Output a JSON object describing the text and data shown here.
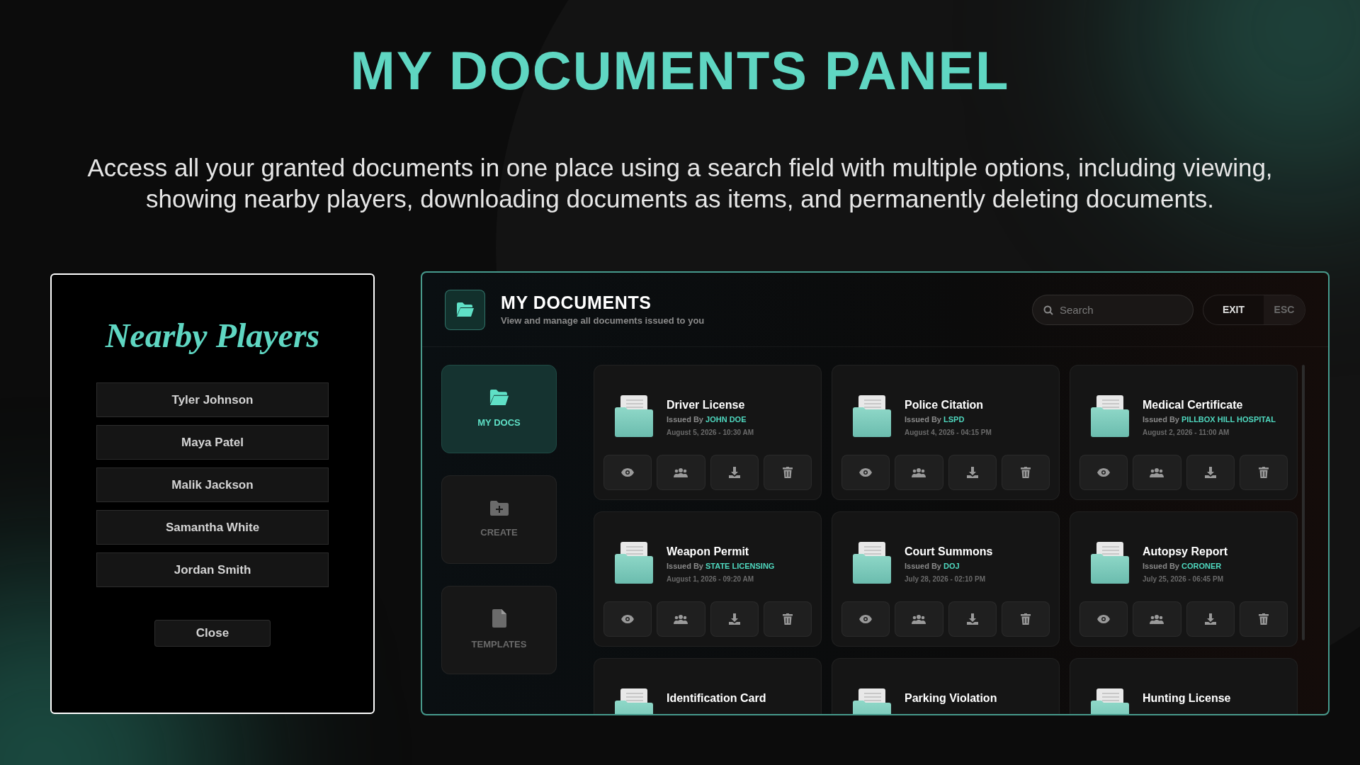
{
  "page": {
    "title": "MY DOCUMENTS PANEL",
    "description": "Access all your granted documents in one place using a search field with multiple options, including viewing, showing nearby players, downloading documents as items, and permanently deleting documents."
  },
  "nearby_players": {
    "title": "Nearby Players",
    "players": [
      "Tyler Johnson",
      "Maya Patel",
      "Malik Jackson",
      "Samantha White",
      "Jordan Smith"
    ],
    "close": "Close"
  },
  "documents_panel": {
    "title": "MY DOCUMENTS",
    "subtitle": "View and manage all documents issued to you",
    "search": {
      "placeholder": "Search"
    },
    "exit": "EXIT",
    "esc": "ESC",
    "nav": [
      {
        "label": "MY DOCS",
        "kind": "docs",
        "selected": true
      },
      {
        "label": "CREATE",
        "kind": "create",
        "selected": false
      },
      {
        "label": "TEMPLATES",
        "kind": "templates",
        "selected": false
      }
    ],
    "documents": [
      {
        "title": "Driver License",
        "issued_by": "Issued By",
        "issuer": "JOHN DOE",
        "date": "August 5, 2026 - 10:30 AM"
      },
      {
        "title": "Police Citation",
        "issued_by": "Issued By",
        "issuer": "LSPD",
        "date": "August 4, 2026 - 04:15 PM"
      },
      {
        "title": "Medical Certificate",
        "issued_by": "Issued By",
        "issuer": "PILLBOX HILL HOSPITAL",
        "date": "August 2, 2026 - 11:00 AM"
      },
      {
        "title": "Weapon Permit",
        "issued_by": "Issued By",
        "issuer": "STATE LICENSING",
        "date": "August 1, 2026 - 09:20 AM"
      },
      {
        "title": "Court Summons",
        "issued_by": "Issued By",
        "issuer": "DOJ",
        "date": "July 28, 2026 - 02:10 PM"
      },
      {
        "title": "Autopsy Report",
        "issued_by": "Issued By",
        "issuer": "CORONER",
        "date": "July 25, 2026 - 06:45 PM"
      },
      {
        "title": "Identification Card"
      },
      {
        "title": "Parking Violation"
      },
      {
        "title": "Hunting License"
      }
    ]
  }
}
